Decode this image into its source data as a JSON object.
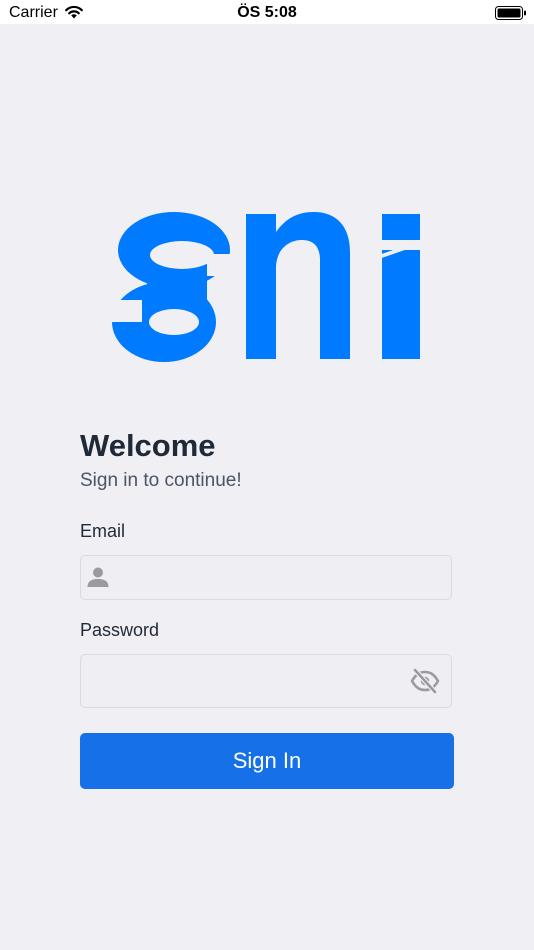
{
  "status_bar": {
    "carrier": "Carrier",
    "time": "ÖS 5:08"
  },
  "logo": {
    "brand_color": "#007aff"
  },
  "login": {
    "title": "Welcome",
    "subtitle": "Sign in to continue!",
    "email_label": "Email",
    "email_value": "",
    "password_label": "Password",
    "password_value": "",
    "submit_label": "Sign In"
  },
  "icons": {
    "user": "user-icon",
    "password_toggle": "eye-slash-icon"
  },
  "colors": {
    "primary": "#1670e8",
    "background": "#efeff4",
    "icon_gray": "#9a9aa0"
  }
}
